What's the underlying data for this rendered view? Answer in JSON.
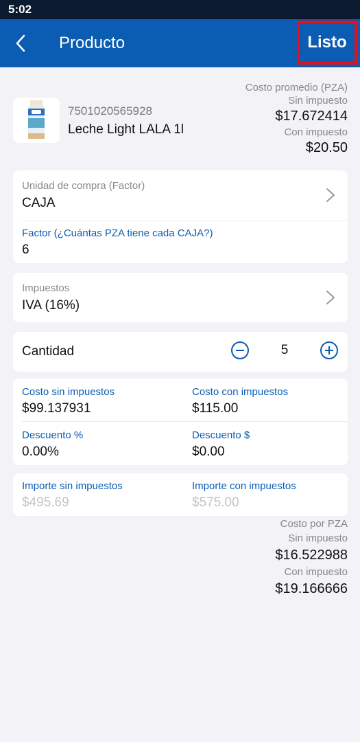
{
  "status": {
    "time": "5:02"
  },
  "app_bar": {
    "title": "Producto",
    "done_label": "Listo"
  },
  "product": {
    "barcode": "7501020565928",
    "name": "Leche Light LALA 1l",
    "avg_cost_label": "Costo promedio (PZA)",
    "no_tax_label": "Sin impuesto",
    "no_tax_value": "$17.672414",
    "with_tax_label": "Con impuesto",
    "with_tax_value": "$20.50"
  },
  "purchase_unit": {
    "label": "Unidad de compra (Factor)",
    "value": "CAJA",
    "factor_label": "Factor (¿Cuántas PZA tiene cada CAJA?)",
    "factor_value": "6"
  },
  "taxes": {
    "label": "Impuestos",
    "value": "IVA (16%)"
  },
  "quantity": {
    "label": "Cantidad",
    "value": "5"
  },
  "costs": {
    "cost_no_tax_label": "Costo sin impuestos",
    "cost_no_tax_value": "$99.137931",
    "cost_with_tax_label": "Costo con impuestos",
    "cost_with_tax_value": "$115.00",
    "discount_pct_label": "Descuento %",
    "discount_pct_value": "0.00%",
    "discount_amt_label": "Descuento $",
    "discount_amt_value": "$0.00"
  },
  "amounts": {
    "no_tax_label": "Importe sin impuestos",
    "no_tax_value": "$495.69",
    "with_tax_label": "Importe con impuestos",
    "with_tax_value": "$575.00"
  },
  "per_unit": {
    "label": "Costo por PZA",
    "no_tax_label": "Sin impuesto",
    "no_tax_value": "$16.522988",
    "with_tax_label": "Con impuesto",
    "with_tax_value": "$19.166666"
  },
  "colors": {
    "primary": "#0a5db3",
    "status_bar": "#0b1a2e",
    "highlight": "#e0121f"
  }
}
